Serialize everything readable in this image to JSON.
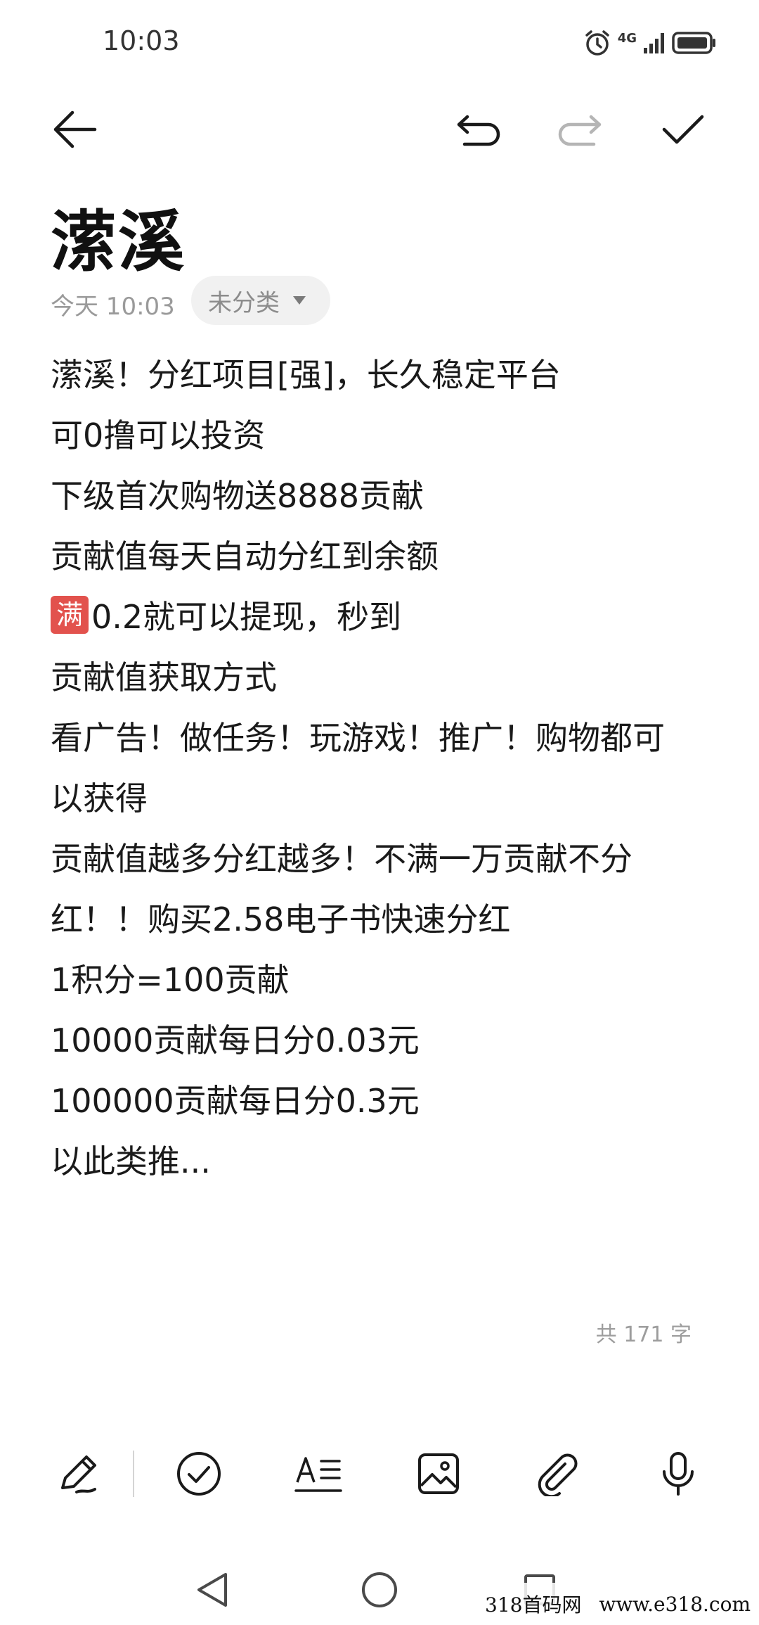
{
  "status_bar": {
    "time": "10:03",
    "network_label": "4G",
    "icons": [
      "alarm-icon",
      "signal-icon",
      "battery-icon"
    ]
  },
  "toolbar": {
    "icons": [
      "back-arrow-icon",
      "undo-icon",
      "redo-icon",
      "check-icon"
    ]
  },
  "note": {
    "title": "潆溪",
    "time": "今天 10:03",
    "category": "未分类",
    "badge": "满",
    "lines": [
      "潆溪！分红项目[强]，长久稳定平台",
      "可0撸可以投资",
      "下级首次购物送8888贡献",
      "贡献值每天自动分红到余额",
      "0.2就可以提现，秒到",
      "贡献值获取方式",
      "看广告！做任务！玩游戏！推广！购物都可",
      "以获得",
      "贡献值越多分红越多！不满一万贡献不分",
      "红！！购买2.58电子书快速分红",
      "1积分=100贡献",
      "10000贡献每日分0.03元",
      "100000贡献每日分0.3元",
      "以此类推..."
    ],
    "char_count": "共 171 字"
  },
  "bottom_tools": [
    "pen-icon",
    "checklist-icon",
    "text-format-icon",
    "image-icon",
    "attachment-icon",
    "microphone-icon"
  ],
  "nav": [
    "nav-back-icon",
    "nav-home-icon",
    "nav-recents-icon"
  ],
  "watermark": {
    "left": "318首码网",
    "right": "www.e318.com"
  },
  "colors": {
    "badge": "#e2524d",
    "muted_text": "#9a9a9a",
    "chip_bg": "#f1f1f1"
  }
}
